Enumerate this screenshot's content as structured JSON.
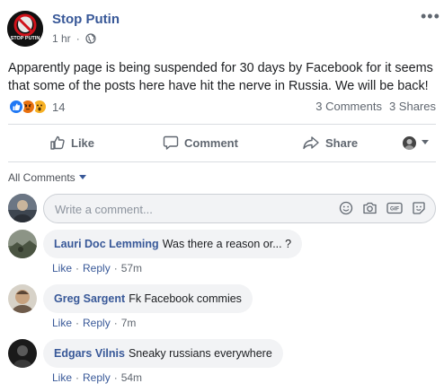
{
  "post": {
    "page_name": "Stop Putin",
    "avatar_text": "STOP PUTIN",
    "time": "1 hr",
    "privacy_icon": "globe-icon",
    "more_label": "•••",
    "text": "Apparently page is being suspended for 30 days by Facebook for it seems that some of the posts here have hit the nerve in Russia. We will be back!",
    "reactions": {
      "icons": [
        "like-reaction-icon",
        "angry-reaction-icon",
        "wow-reaction-icon"
      ],
      "count": "14"
    },
    "comments_count": "3 Comments",
    "shares_count": "3 Shares"
  },
  "actions": {
    "like": "Like",
    "comment": "Comment",
    "share": "Share"
  },
  "comments_section": {
    "filter_label": "All Comments",
    "composer_placeholder": "Write a comment...",
    "composer_icons": [
      "emoji-icon",
      "camera-icon",
      "gif-icon",
      "sticker-icon"
    ]
  },
  "comments": [
    {
      "author": "Lauri Doc Lemming",
      "text": "Was there a reason or... ?",
      "like": "Like",
      "reply": "Reply",
      "time": "57m"
    },
    {
      "author": "Greg Sargent",
      "text": "Fk Facebook commies",
      "like": "Like",
      "reply": "Reply",
      "time": "7m"
    },
    {
      "author": "Edgars Vilnis",
      "text": "Sneaky russians everywhere",
      "like": "Like",
      "reply": "Reply",
      "time": "54m"
    }
  ],
  "colors": {
    "link": "#385898",
    "secondary_text": "#606770",
    "like_blue": "#2078f4",
    "bubble_bg": "#f2f3f5"
  }
}
